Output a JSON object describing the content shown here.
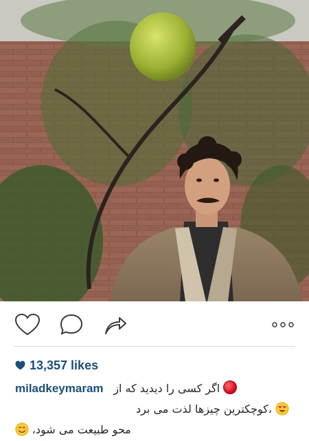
{
  "post": {
    "image_alt": "Man with curly hair standing in front of a brick wall under a hanging green fruit",
    "likes_count": "13,357 likes",
    "username": "miladkeymaram",
    "caption_line1": "اگر کسی را دیدید که از",
    "caption_line2": "،کوچکترین چیزها لذت می برد",
    "caption_line3": "محو طبیعت می شود،"
  },
  "icons": {
    "like": "heart-outline-icon",
    "comment": "comment-bubble-icon",
    "share": "share-arrow-icon",
    "more": "more-options-icon",
    "likes_heart": "heart-filled-icon"
  },
  "colors": {
    "accent": "#1b4f7a",
    "text": "#262626",
    "divider": "#dbdbdb"
  }
}
